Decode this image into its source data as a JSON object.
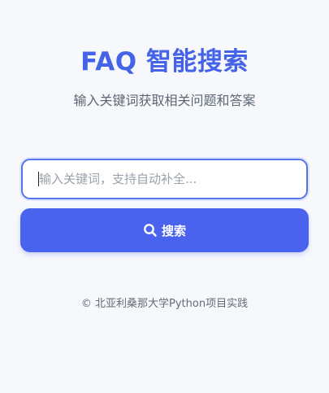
{
  "header": {
    "title": "FAQ 智能搜索",
    "subtitle": "输入关键词获取相关问题和答案"
  },
  "search": {
    "placeholder": "输入关键词，支持自动补全...",
    "value": "",
    "button_label": "搜索",
    "button_icon": "search-icon"
  },
  "footer": {
    "text": "© 北亚利桑那大学Python项目实践"
  },
  "colors": {
    "accent": "#4a63ee",
    "title": "#4463e6",
    "background": "#f7f8fc"
  }
}
